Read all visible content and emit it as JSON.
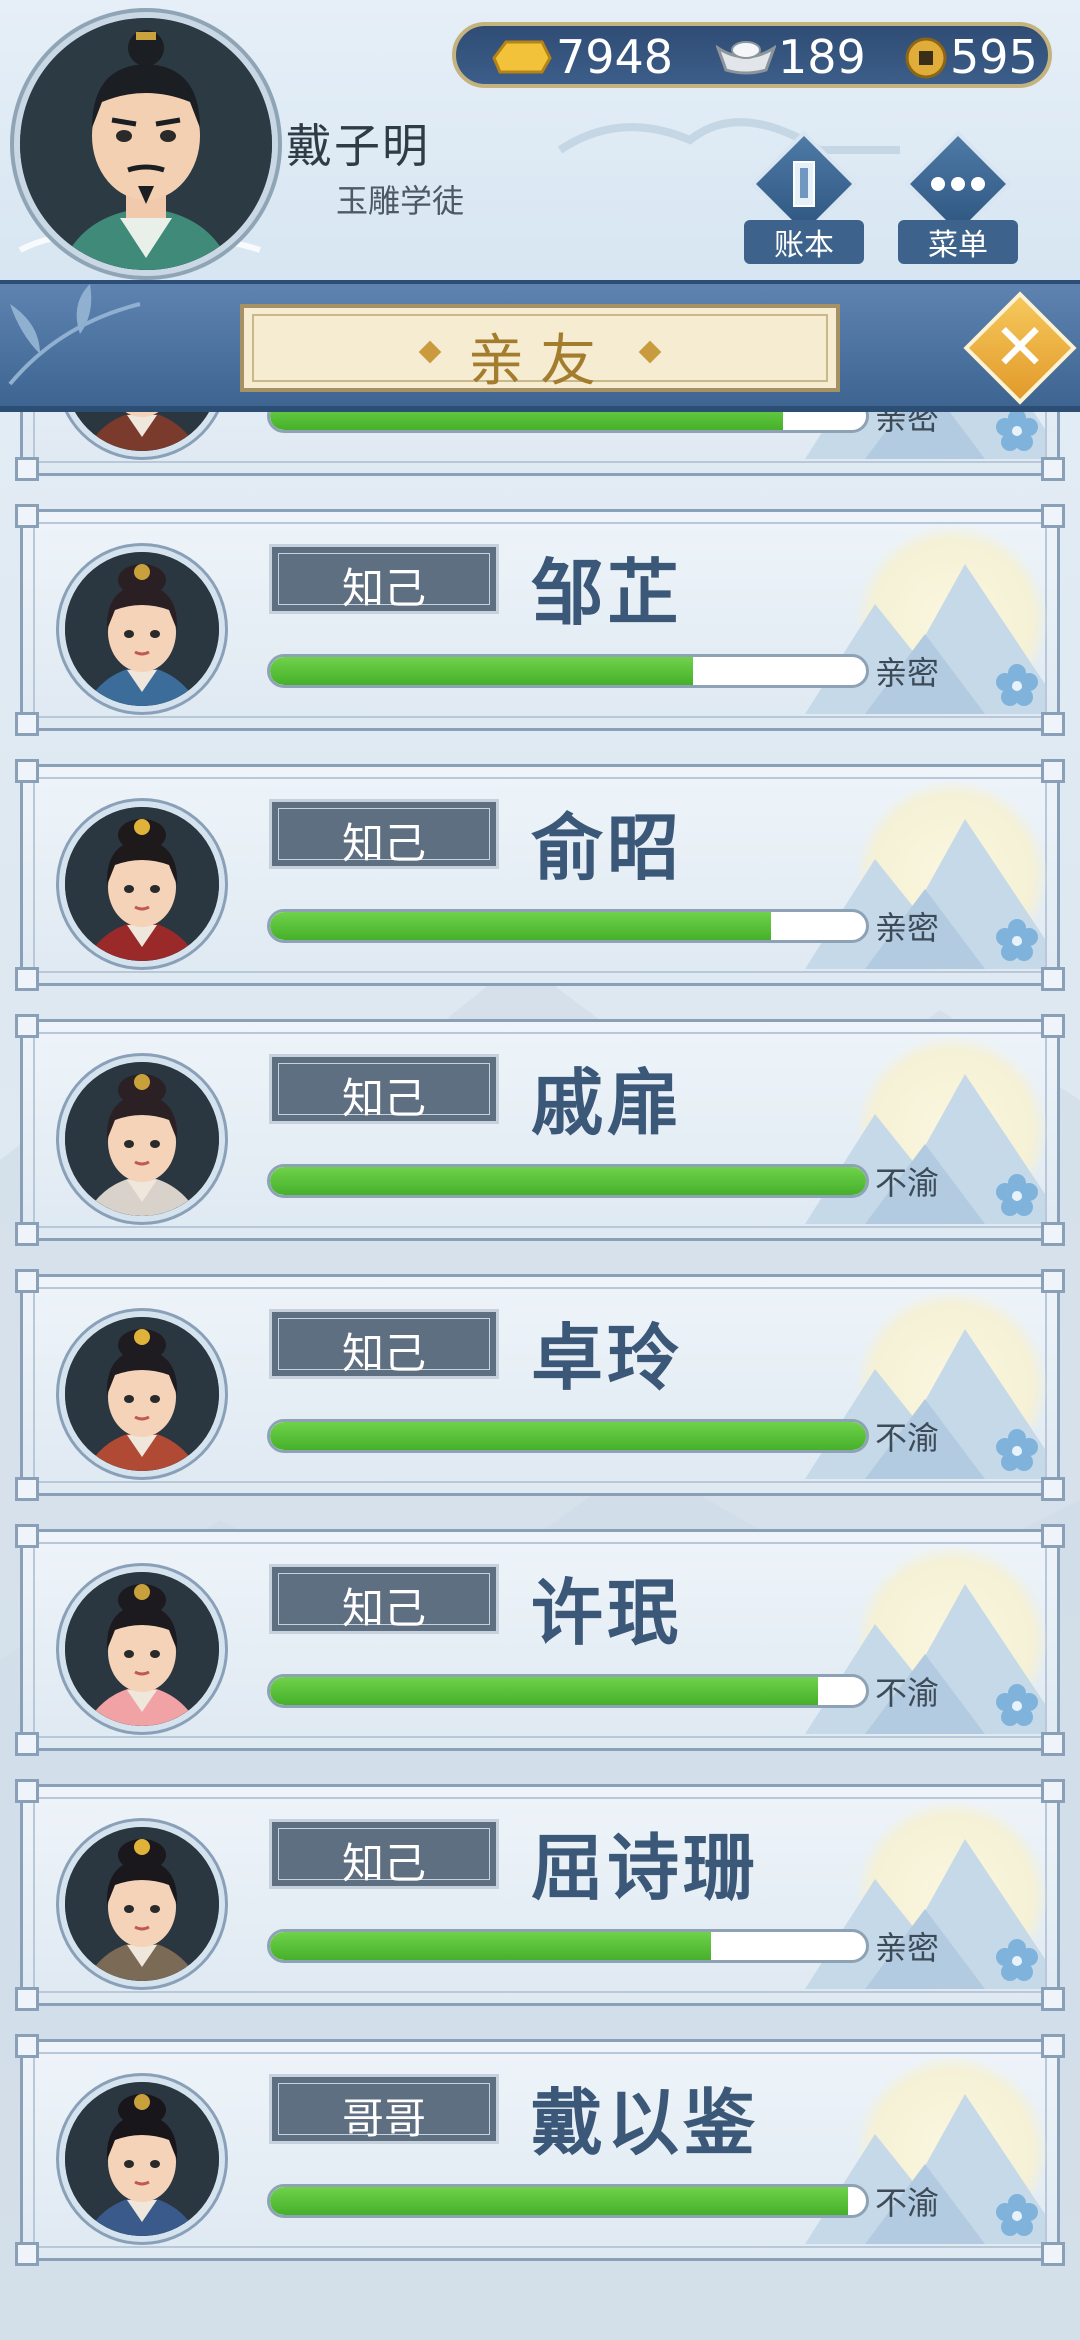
{
  "player": {
    "name": "戴子明",
    "title": "玉雕学徒"
  },
  "currency": [
    {
      "icon": "gold-ingot-icon",
      "value": "7948"
    },
    {
      "icon": "silver-ingot-icon",
      "value": "189"
    },
    {
      "icon": "coin-icon",
      "value": "595"
    }
  ],
  "header_buttons": {
    "ledger_label": "账本",
    "menu_label": "菜单"
  },
  "page": {
    "title": "亲友"
  },
  "colors": {
    "accent": "#3e6592",
    "bar_fill": "#46b02a",
    "title_gold": "#a47c2e"
  },
  "friends": [
    {
      "relation": "",
      "name": "",
      "affinity": 0.86,
      "status": "亲密"
    },
    {
      "relation": "知己",
      "name": "邹芷",
      "affinity": 0.71,
      "status": "亲密"
    },
    {
      "relation": "知己",
      "name": "俞昭",
      "affinity": 0.84,
      "status": "亲密"
    },
    {
      "relation": "知己",
      "name": "戚扉",
      "affinity": 1.0,
      "status": "不渝"
    },
    {
      "relation": "知己",
      "name": "卓玲",
      "affinity": 1.0,
      "status": "不渝"
    },
    {
      "relation": "知己",
      "name": "许珉",
      "affinity": 0.92,
      "status": "不渝"
    },
    {
      "relation": "知己",
      "name": "屈诗珊",
      "affinity": 0.74,
      "status": "亲密"
    },
    {
      "relation": "哥哥",
      "name": "戴以鉴",
      "affinity": 0.97,
      "status": "不渝"
    }
  ]
}
